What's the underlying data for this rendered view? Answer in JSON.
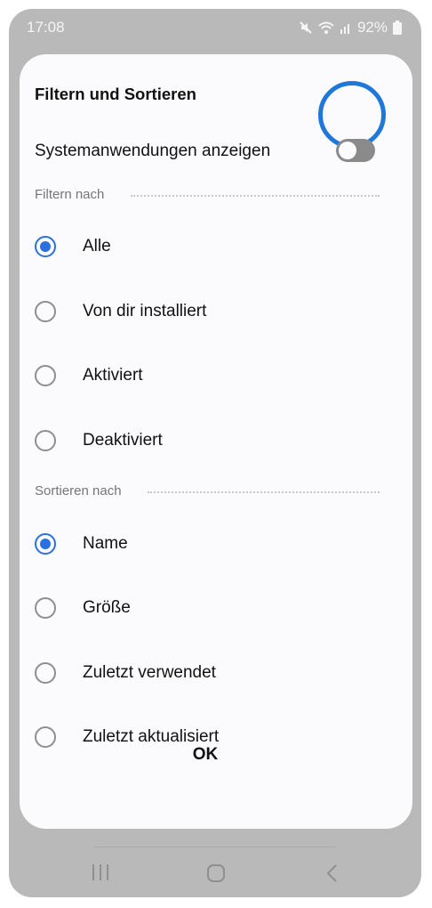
{
  "status_bar": {
    "time": "17:08",
    "battery": "92%"
  },
  "dialog": {
    "title": "Filtern und Sortieren",
    "toggle": {
      "label": "Systemanwendungen anzeigen",
      "on": false
    },
    "filter": {
      "heading": "Filtern nach",
      "options": [
        {
          "label": "Alle",
          "checked": true
        },
        {
          "label": "Von dir installiert",
          "checked": false
        },
        {
          "label": "Aktiviert",
          "checked": false
        },
        {
          "label": "Deaktiviert",
          "checked": false
        }
      ]
    },
    "sort": {
      "heading": "Sortieren nach",
      "options": [
        {
          "label": "Name",
          "checked": true
        },
        {
          "label": "Größe",
          "checked": false
        },
        {
          "label": "Zuletzt verwendet",
          "checked": false
        },
        {
          "label": "Zuletzt aktualisiert",
          "checked": false
        }
      ]
    },
    "ok_label": "OK"
  },
  "colors": {
    "accent": "#2b6fe0",
    "highlight_ring": "#1f78d9"
  },
  "icons": [
    "mute-icon",
    "wifi-icon",
    "signal-icon",
    "battery-icon",
    "recents-icon",
    "home-icon",
    "back-icon"
  ]
}
